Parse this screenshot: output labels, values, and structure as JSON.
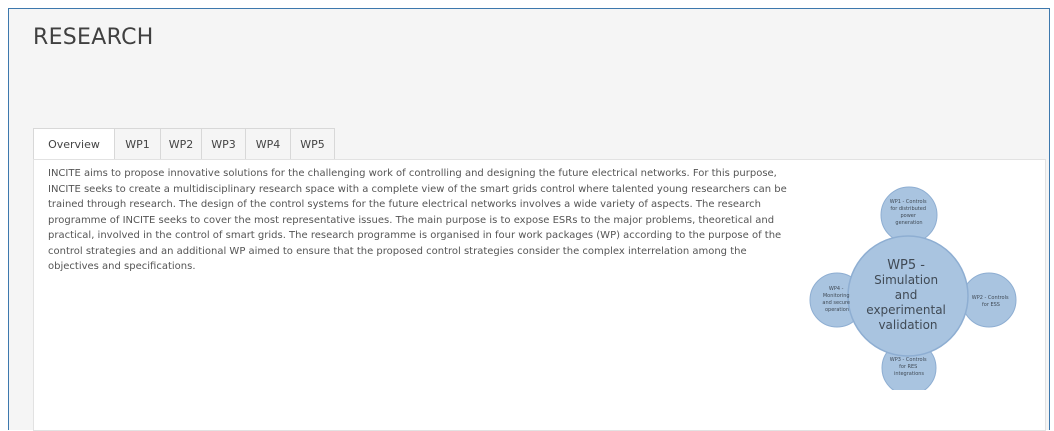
{
  "page": {
    "title": "RESEARCH"
  },
  "tabs": [
    {
      "label": "Overview",
      "active": true
    },
    {
      "label": "WP1",
      "active": false
    },
    {
      "label": "WP2",
      "active": false
    },
    {
      "label": "WP3",
      "active": false
    },
    {
      "label": "WP4",
      "active": false
    },
    {
      "label": "WP5",
      "active": false
    }
  ],
  "overview": {
    "text": "INCITE aims to propose innovative solutions for the challenging work of controlling and designing the future electrical networks. For this purpose, INCITE seeks to create a multidisciplinary research space with a complete view of the smart grids control where talented young researchers can be trained through research. The design of the control systems for the future electrical networks involves a wide variety of aspects. The research programme of INCITE seeks to cover the most representative issues. The main purpose is to expose ESRs to the major problems, theoretical and practical, involved in the control of smart grids. The research programme is organised in four work packages (WP) according to the purpose of the control strategies and an additional WP aimed to ensure that the proposed control strategies consider the complex interrelation among the objectives and specifications."
  },
  "diagram": {
    "center": [
      "WP5 -",
      "Simulation",
      "and",
      "experimental",
      "validation"
    ],
    "top": [
      "WP1 - Controls",
      "for distributed",
      "power",
      "generation"
    ],
    "right": [
      "WP2 - Controls",
      "for ESS"
    ],
    "bottom": [
      "WP3 - Controls",
      "for RES",
      "integrations"
    ],
    "left": [
      "WP4 -",
      "Monitoring",
      "and secure",
      "operation"
    ]
  },
  "colors": {
    "frame_border": "#3d78ad",
    "circle_fill": "#a9c4e0",
    "circle_stroke": "#8eaed2",
    "text": "#555555"
  }
}
